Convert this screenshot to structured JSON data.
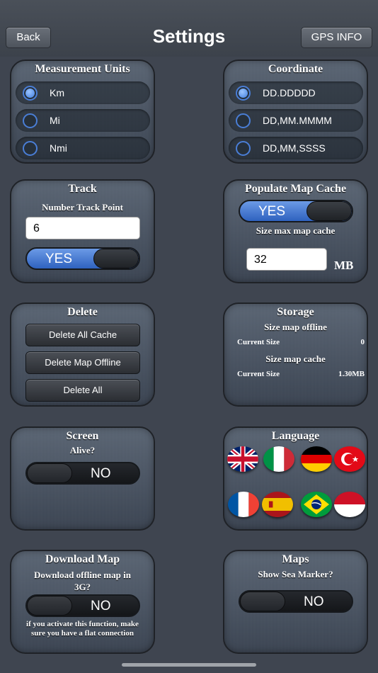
{
  "header": {
    "back_label": "Back",
    "title": "Settings",
    "gps_label": "GPS INFO"
  },
  "units": {
    "title": "Measurement Units",
    "options": [
      {
        "label": "Km",
        "selected": true
      },
      {
        "label": "Mi",
        "selected": false
      },
      {
        "label": "Nmi",
        "selected": false
      }
    ]
  },
  "coordinate": {
    "title": "Coordinate",
    "options": [
      {
        "label": "DD.DDDDD",
        "selected": true
      },
      {
        "label": "DD,MM.MMMM",
        "selected": false
      },
      {
        "label": "DD,MM,SSSS",
        "selected": false
      }
    ]
  },
  "track": {
    "title": "Track",
    "subtitle": "Number Track Point",
    "value": "6",
    "toggle_label": "YES",
    "toggle_on": true
  },
  "cache": {
    "title": "Populate Map Cache",
    "toggle_label": "YES",
    "toggle_on": true,
    "size_label": "Size max map cache",
    "size_value": "32",
    "unit": "MB"
  },
  "delete": {
    "title": "Delete",
    "buttons": [
      "Delete All Cache",
      "Delete Map Offline",
      "Delete All"
    ]
  },
  "storage": {
    "title": "Storage",
    "offline_label": "Size map offline",
    "offline_row": {
      "label": "Current Size",
      "value": "0"
    },
    "cache_label": "Size map cache",
    "cache_row": {
      "label": "Current Size",
      "value": "1.30MB"
    }
  },
  "screen": {
    "title": "Screen",
    "subtitle": "Alive?",
    "toggle_label": "NO",
    "toggle_on": false
  },
  "language": {
    "title": "Language",
    "flags": [
      "uk-flag-icon",
      "italy-flag-icon",
      "germany-flag-icon",
      "turkey-flag-icon",
      "france-flag-icon",
      "spain-flag-icon",
      "brazil-flag-icon",
      "indonesia-flag-icon"
    ]
  },
  "download": {
    "title": "Download Map",
    "subtitle": "Download offline map in 3G?",
    "toggle_label": "NO",
    "toggle_on": false,
    "note": "if you activate this function, make sure you have a flat connection"
  },
  "maps": {
    "title": "Maps",
    "subtitle": "Show Sea Marker?",
    "toggle_label": "NO",
    "toggle_on": false
  },
  "colors": {
    "background": "#3f4550",
    "accent_blue": "#3f7de0"
  }
}
